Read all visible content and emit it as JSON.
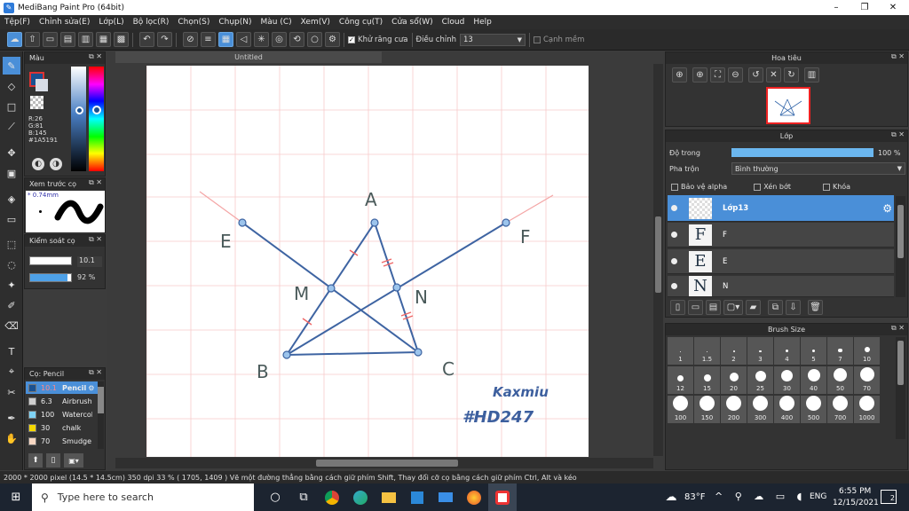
{
  "window": {
    "title": "MediBang Paint Pro (64bit)",
    "minimize": "–",
    "maximize": "❐",
    "close": "✕"
  },
  "menu": [
    "Tệp(F)",
    "Chỉnh sửa(E)",
    "Lớp(L)",
    "Bộ lọc(R)",
    "Chọn(S)",
    "Chụp(N)",
    "Màu (C)",
    "Xem(V)",
    "Công cụ(T)",
    "Cửa sổ(W)",
    "Cloud",
    "Help"
  ],
  "toolbar": {
    "antialias_label": "Khử răng cưa",
    "correction_label": "Điều chỉnh",
    "correction_value": "13",
    "edge_label": "Cạnh mềm"
  },
  "color_panel": {
    "title": "Màu",
    "r": "R:26",
    "g": "G:81",
    "b": "B:145",
    "hex": "#1A5191",
    "color": "#1A5191"
  },
  "brush_preview": {
    "title": "Xem trước cọ",
    "size": "0.74mm"
  },
  "brush_control": {
    "title": "Kiểm soát cọ",
    "size": "10.1",
    "opacity": "92 %",
    "opacity_fraction": 0.92
  },
  "brush_list": {
    "title": "Cọ: Pencil",
    "items": [
      {
        "size": "10.1",
        "name": "Pencil",
        "color": "#1A5191"
      },
      {
        "size": "6.3",
        "name": "Airbrush",
        "color": "#cfcfcf"
      },
      {
        "size": "100",
        "name": "Watercolor",
        "color": "#7fd3f5"
      },
      {
        "size": "30",
        "name": "chalk",
        "color": "#f5d800"
      },
      {
        "size": "70",
        "name": "Smudge",
        "color": "#f7d7c2"
      }
    ]
  },
  "document": {
    "tab": "Untitled"
  },
  "drawing": {
    "labels": {
      "A": "A",
      "B": "B",
      "C": "C",
      "E": "E",
      "F": "F",
      "M": "M",
      "N": "N"
    },
    "signature": [
      "Kaxmiu",
      "#HD247"
    ]
  },
  "navigator": {
    "title": "Hoa tiêu"
  },
  "layer_panel": {
    "title": "Lớp",
    "opacity_label": "Độ trong",
    "opacity_value": "100 %",
    "blend_label": "Pha trộn",
    "blend_value": "Bình thường",
    "protect_alpha": "Bảo vệ alpha",
    "clipping": "Xén bớt",
    "lock": "Khóa",
    "layers": [
      {
        "name": "Lớp13",
        "thumb": "",
        "selected": true
      },
      {
        "name": "F",
        "thumb": "F",
        "selected": false
      },
      {
        "name": "E",
        "thumb": "E",
        "selected": false
      },
      {
        "name": "N",
        "thumb": "N",
        "selected": false
      }
    ]
  },
  "brush_size": {
    "title": "Brush Size",
    "sizes": [
      "1",
      "1.5",
      "2",
      "3",
      "4",
      "5",
      "7",
      "10",
      "12",
      "15",
      "20",
      "25",
      "30",
      "40",
      "50",
      "70",
      "100",
      "150",
      "200",
      "300",
      "400",
      "500",
      "700",
      "1000"
    ]
  },
  "status": {
    "text": "2000 * 2000 pixel  (14.5 * 14.5cm)  350 dpi  33 %  ( 1705, 1409 )  Vẽ một đường thẳng bằng cách giữ phím Shift, Thay đổi cỡ cọ bằng cách giữ phím Ctrl, Alt và kéo"
  },
  "taskbar": {
    "search_placeholder": "Type here to search",
    "weather": "83°F",
    "lang": "ENG",
    "time": "6:55 PM",
    "date": "12/15/2021",
    "notif": "2"
  }
}
